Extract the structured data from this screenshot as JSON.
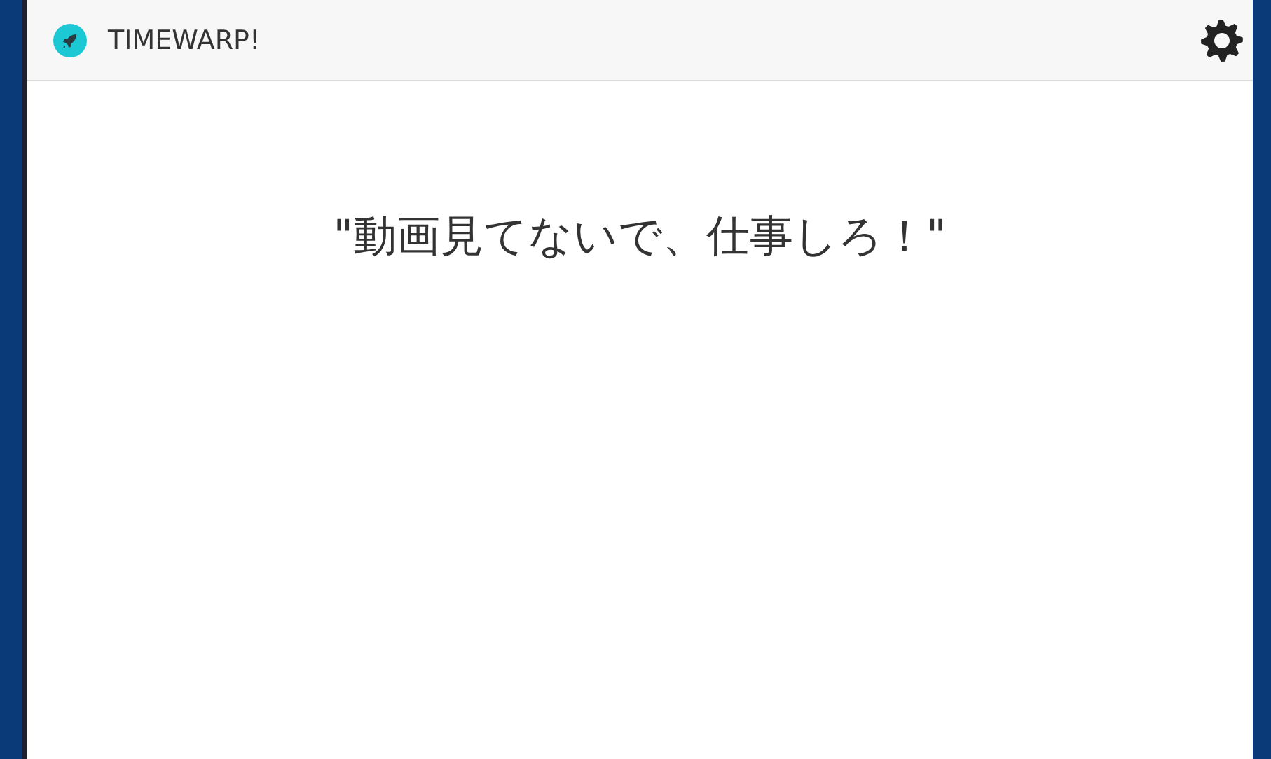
{
  "header": {
    "title": "TIMEWARP!"
  },
  "message": "\"動画見てないで、仕事しろ！\""
}
